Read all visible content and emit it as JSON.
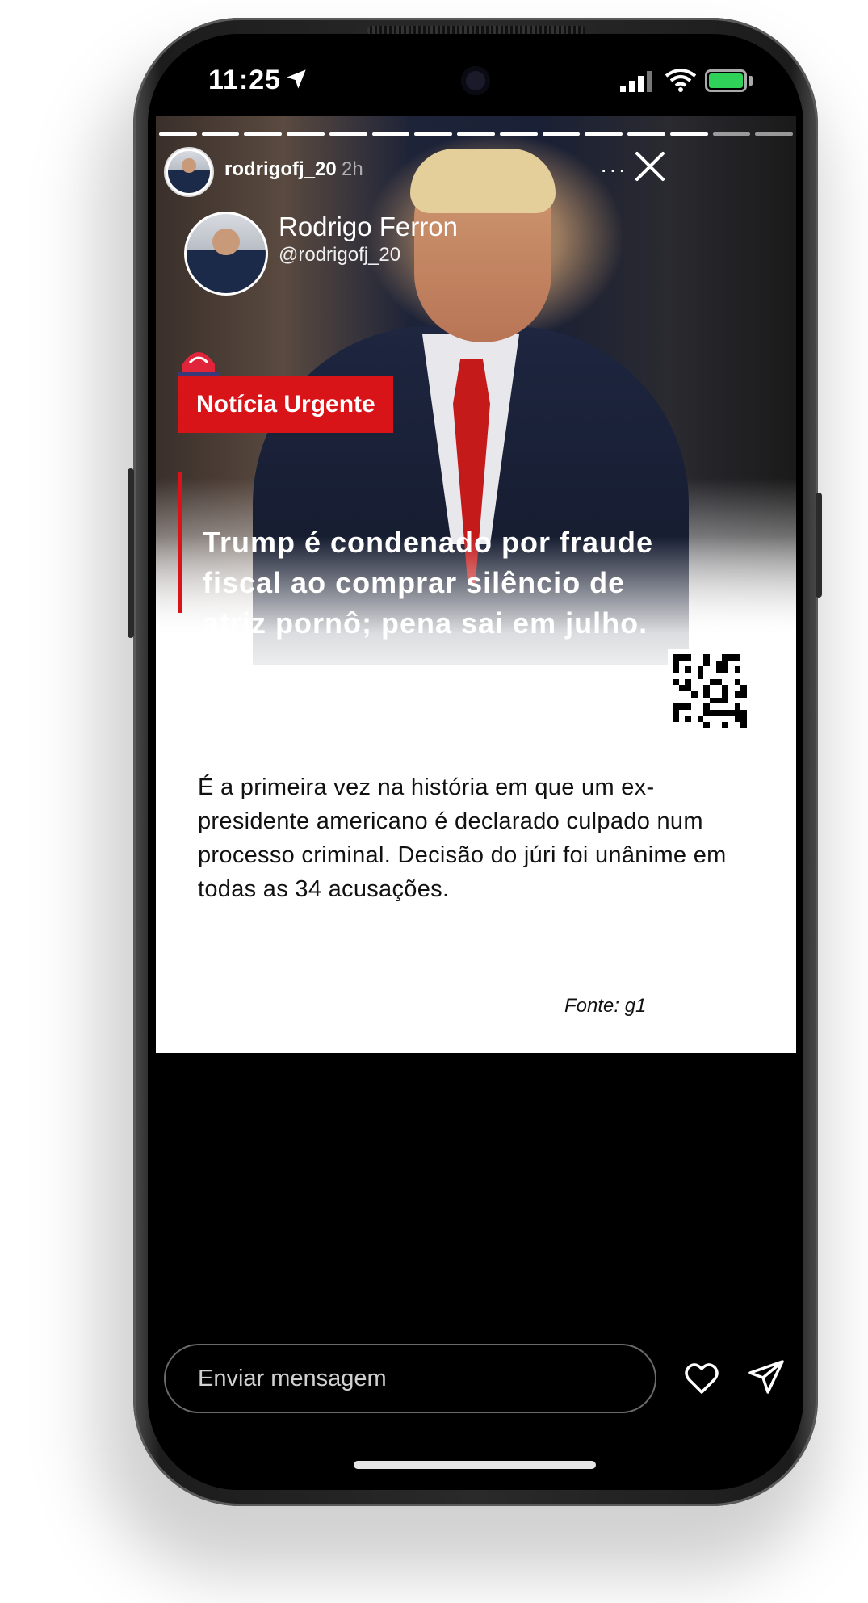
{
  "status_bar": {
    "time": "11:25",
    "battery_color": "#2fd158"
  },
  "story_header": {
    "username": "rodrigofj_20",
    "time_ago": "2h",
    "more_label": "···"
  },
  "post": {
    "brand_name": "Rodrigo Ferron",
    "brand_handle": "@rodrigofj_20",
    "badge": "Notícia Urgente",
    "badge_color": "#d81418",
    "headline": "Trump é condenado por fraude fiscal ao comprar silêncio de atriz pornô; pena sai em julho.",
    "body": "É a primeira vez na história em que um ex-presidente americano é declarado culpado num processo criminal. Decisão do júri foi unânime em todas as 34 acusações.",
    "source": "Fonte: g1"
  },
  "reply_bar": {
    "placeholder": "Enviar mensagem"
  },
  "icons": {
    "location": "location-arrow-icon",
    "signal": "signal-bars-icon",
    "wifi": "wifi-icon",
    "battery": "battery-icon",
    "close": "close-icon",
    "heart": "heart-icon",
    "send": "send-icon",
    "siren": "siren-icon"
  }
}
